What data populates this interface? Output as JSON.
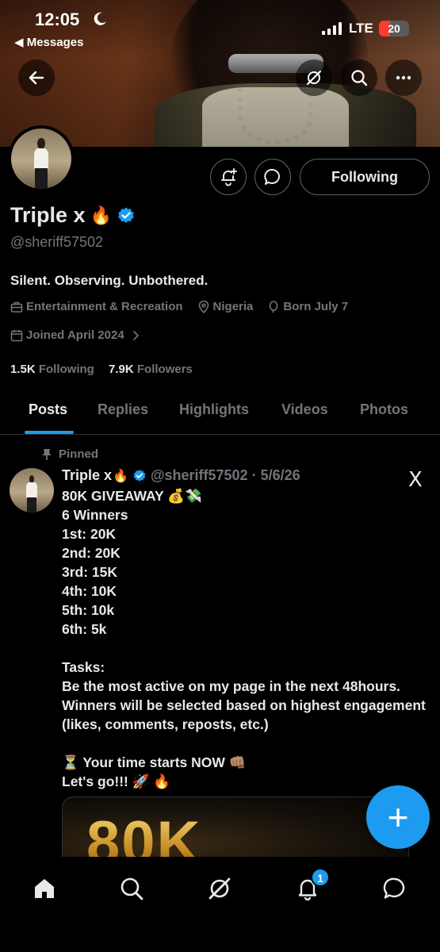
{
  "status_bar": {
    "time": "12:05",
    "back_label": "◀ Messages",
    "network": "LTE",
    "battery": "20",
    "accent_battery": "#ff3b30"
  },
  "banner_actions": {
    "back_icon": "arrow-left-icon",
    "grok_icon": "grok-icon",
    "search_icon": "search-icon",
    "more_icon": "more-icon"
  },
  "profile": {
    "name": "Triple x",
    "name_emoji": "🔥",
    "handle": "@sheriff57502",
    "bio": "Silent. Observing. Unbothered.",
    "category": "Entertainment & Recreation",
    "location": "Nigeria",
    "born": "Born July 7",
    "joined": "Joined April 2024",
    "following_count": "1.5K",
    "following_label": "Following",
    "followers_count": "7.9K",
    "followers_label": "Followers",
    "follow_button": "Following",
    "verified_color": "#1d9bf0"
  },
  "tabs": [
    {
      "label": "Posts",
      "active": true
    },
    {
      "label": "Replies",
      "active": false
    },
    {
      "label": "Highlights",
      "active": false
    },
    {
      "label": "Videos",
      "active": false
    },
    {
      "label": "Photos",
      "active": false
    }
  ],
  "post": {
    "pinned_label": "Pinned",
    "author": "Triple x",
    "author_emoji": "🔥",
    "handle_date": "@sheriff57502 · 5/6/26",
    "text": "80K GIVEAWAY 💰💸\n6 Winners\n1st:  20K\n2nd: 20K\n3rd: 15K\n4th: 10K\n5th: 10k\n6th: 5k\n\nTasks:\nBe the most active on my page in the next 48hours.\nWinners will be selected based on highest engagement (likes, comments, reposts, etc.)\n\n⏳ Your time starts NOW 👊🏽\nLet's go!!! 🚀 🔥",
    "media_text": "80K",
    "source_logo": "X"
  },
  "fab_label": "+",
  "bottom_nav": {
    "items": [
      "home-icon",
      "search-icon",
      "grok-icon",
      "notifications-icon",
      "messages-icon"
    ],
    "notification_count": "1"
  }
}
